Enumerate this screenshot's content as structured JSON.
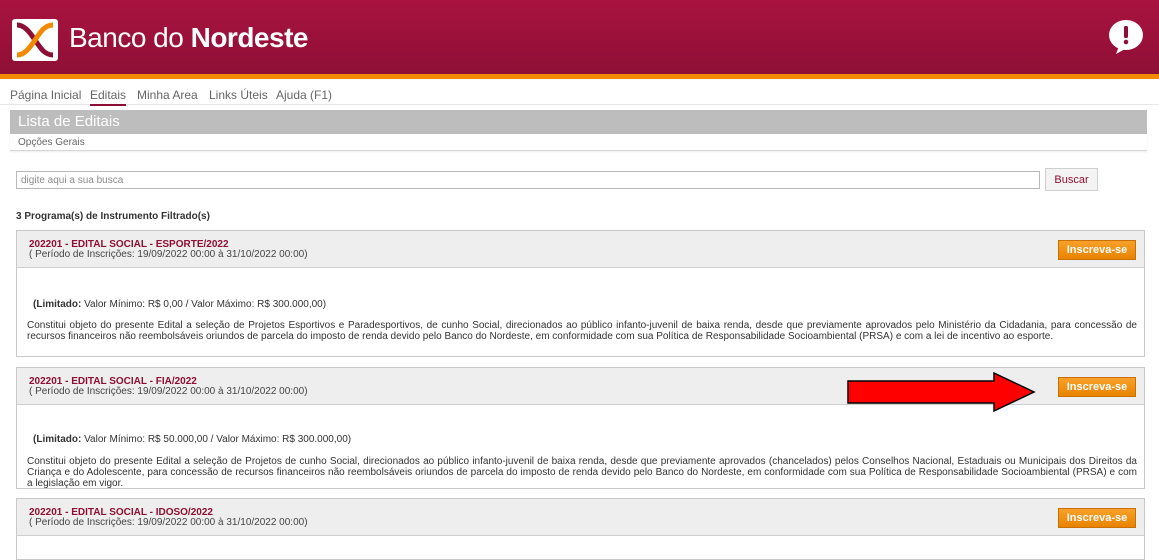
{
  "header": {
    "brand_regular": "Banco do ",
    "brand_bold": "Nordeste",
    "colors": {
      "primary": "#8e0f35",
      "accent": "#f18a00"
    },
    "help_icon": "speech-bubble-exclamation-icon"
  },
  "nav": {
    "items": [
      {
        "label": "Página Inicial"
      },
      {
        "label": "Editais"
      },
      {
        "label": "Minha Area"
      },
      {
        "label": "Links Úteis"
      },
      {
        "label": "Ajuda (F1)"
      }
    ],
    "active": "Editais"
  },
  "section": {
    "title": "Lista de Editais",
    "subtitle": "Opções Gerais"
  },
  "search": {
    "placeholder": "digite aqui a sua busca",
    "button_label": "Buscar"
  },
  "results_count": "3 Programa(s) de Instrumento Filtrado(s)",
  "editais": [
    {
      "title": "202201 - EDITAL SOCIAL - ESPORTE/2022",
      "period": "( Período de Inscrições: 19/09/2022 00:00 à 31/10/2022 00:00)",
      "button": "Inscreva-se",
      "limit_label": "(Limitado:",
      "limit_text": " Valor Mínimo: R$ 0,00 / Valor Máximo: R$ 300.000,00)",
      "description": "Constitui objeto do presente Edital a seleção de Projetos Esportivos e Paradesportivos, de cunho Social, direcionados ao público infanto-juvenil de baixa renda, desde que previamente aprovados pelo Ministério da Cidadania, para concessão de recursos financeiros não reembolsáveis oriundos de parcela do imposto de renda devido pelo Banco do Nordeste, em conformidade com sua Política de Responsabilidade Socioambiental (PRSA) e com a lei de incentivo ao esporte."
    },
    {
      "title": "202201 - EDITAL SOCIAL - FIA/2022",
      "period": "( Período de Inscrições: 19/09/2022 00:00 à 31/10/2022 00:00)",
      "button": "Inscreva-se",
      "limit_label": "(Limitado:",
      "limit_text": " Valor Mínimo: R$ 50.000,00 / Valor Máximo: R$ 300.000,00)",
      "description": "Constitui objeto do presente Edital a seleção de Projetos de cunho Social, direcionados ao público infanto-juvenil de baixa renda, desde que previamente aprovados (chancelados) pelos Conselhos Nacional, Estaduais ou Municipais dos Direitos da Criança e do Adolescente, para concessão de recursos financeiros não reembolsáveis oriundos de parcela do imposto de renda devido pelo Banco do Nordeste, em conformidade com sua Política de Responsabilidade Socioambiental (PRSA) e com a legislação em vigor."
    },
    {
      "title": "202201 - EDITAL SOCIAL - IDOSO/2022",
      "period": "( Período de Inscrições: 19/09/2022 00:00 à 31/10/2022 00:00)",
      "button": "Inscreva-se"
    }
  ]
}
